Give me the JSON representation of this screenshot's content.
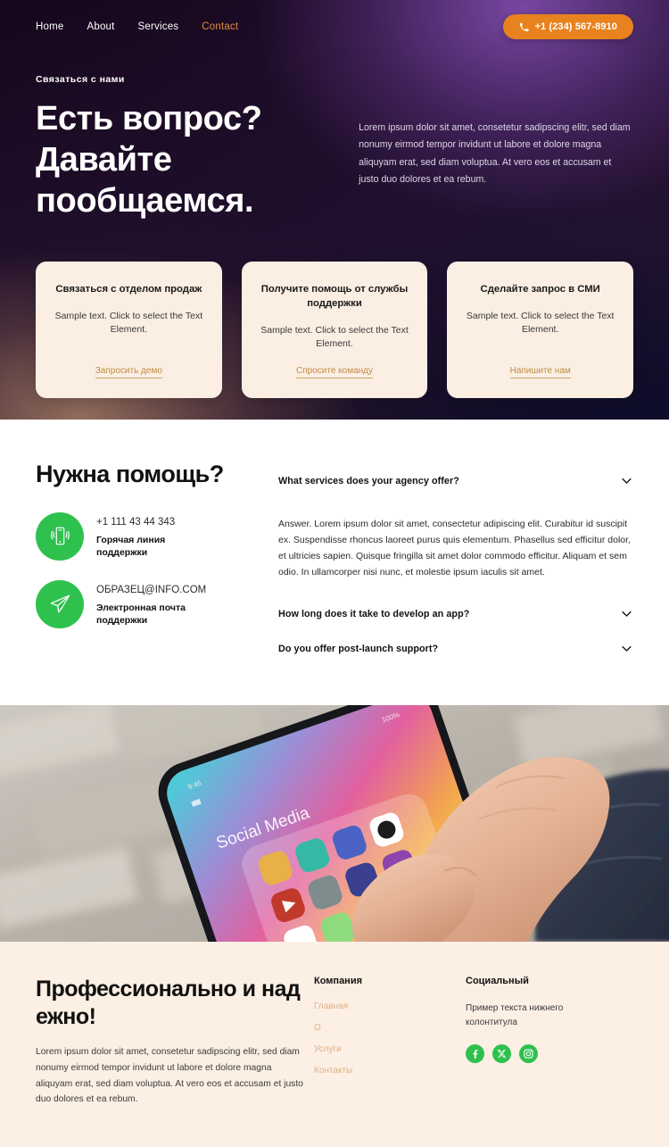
{
  "nav": {
    "links": [
      {
        "label": "Home",
        "active": false
      },
      {
        "label": "About",
        "active": false
      },
      {
        "label": "Services",
        "active": false
      },
      {
        "label": "Contact",
        "active": true
      }
    ],
    "phone_button": {
      "label": "+1 (234) 567-8910",
      "icon": "phone-icon",
      "color": "#e8821e"
    }
  },
  "hero": {
    "eyebrow": "Связаться с нами",
    "title": "Есть вопрос? Давайте пообщаемся.",
    "paragraph": "Lorem ipsum dolor sit amet, consetetur sadipscing elitr, sed diam nonumy eirmod tempor invidunt ut labore et dolore magna aliquyam erat, sed diam voluptua. At vero eos et accusam et justo duo dolores et ea rebum.",
    "cards": [
      {
        "title": "Связаться с отделом продаж",
        "text": "Sample text. Click to select the Text Element.",
        "link": "Запросить демо"
      },
      {
        "title": "Получите помощь от службы поддержки",
        "text": "Sample text. Click to select the Text Element.",
        "link": "Спросите команду"
      },
      {
        "title": "Сделайте запрос в СМИ",
        "text": "Sample text. Click to select the Text Element.",
        "link": "Напишите нам"
      }
    ]
  },
  "help": {
    "title": "Нужна помощь?",
    "contacts": [
      {
        "icon": "mobile-phone-ringing-icon",
        "value": "+1 111 43 44 343",
        "label": "Горячая линия поддержки"
      },
      {
        "icon": "paper-plane-icon",
        "value": "ОБРАЗЕЦ@INFO.COM",
        "label": "Электронная почта поддержки"
      }
    ],
    "faq": [
      {
        "question": "What services does your agency offer?",
        "expanded": true,
        "answer": "Answer. Lorem ipsum dolor sit amet, consectetur adipiscing elit. Curabitur id suscipit ex. Suspendisse rhoncus laoreet purus quis elementum. Phasellus sed efficitur dolor, et ultricies sapien. Quisque fringilla sit amet dolor commodo efficitur. Aliquam et sem odio. In ullamcorper nisi nunc, et molestie ipsum iaculis sit amet."
      },
      {
        "question": "How long does it take to develop an app?",
        "expanded": false,
        "answer": ""
      },
      {
        "question": "Do you offer post-launch support?",
        "expanded": false,
        "answer": ""
      }
    ]
  },
  "photo": {
    "alt": "Hand holding smartphone showing Social Media app folder",
    "screen_label": "Social Media"
  },
  "footer": {
    "title": "Профессионально и надежно!",
    "paragraph": "Lorem ipsum dolor sit amet, consetetur sadipscing elitr, sed diam nonumy eirmod tempor invidunt ut labore et dolore magna aliquyam erat, sed diam voluptua. At vero eos et accusam et justo duo dolores et ea rebum.",
    "company": {
      "title": "Компания",
      "links": [
        "Главная",
        "О",
        "Услуги",
        "Контакты"
      ]
    },
    "social": {
      "title": "Социальный",
      "note": "Пример текста нижнего колонтитула",
      "icons": [
        "facebook-icon",
        "x-twitter-icon",
        "instagram-icon"
      ]
    }
  },
  "colors": {
    "accent_orange": "#e8821e",
    "link_gold": "#c08b46",
    "green": "#2ec14e",
    "card_cream": "#fbeee2",
    "footer_cream": "#fcefe4",
    "footer_link": "#e2b183"
  }
}
